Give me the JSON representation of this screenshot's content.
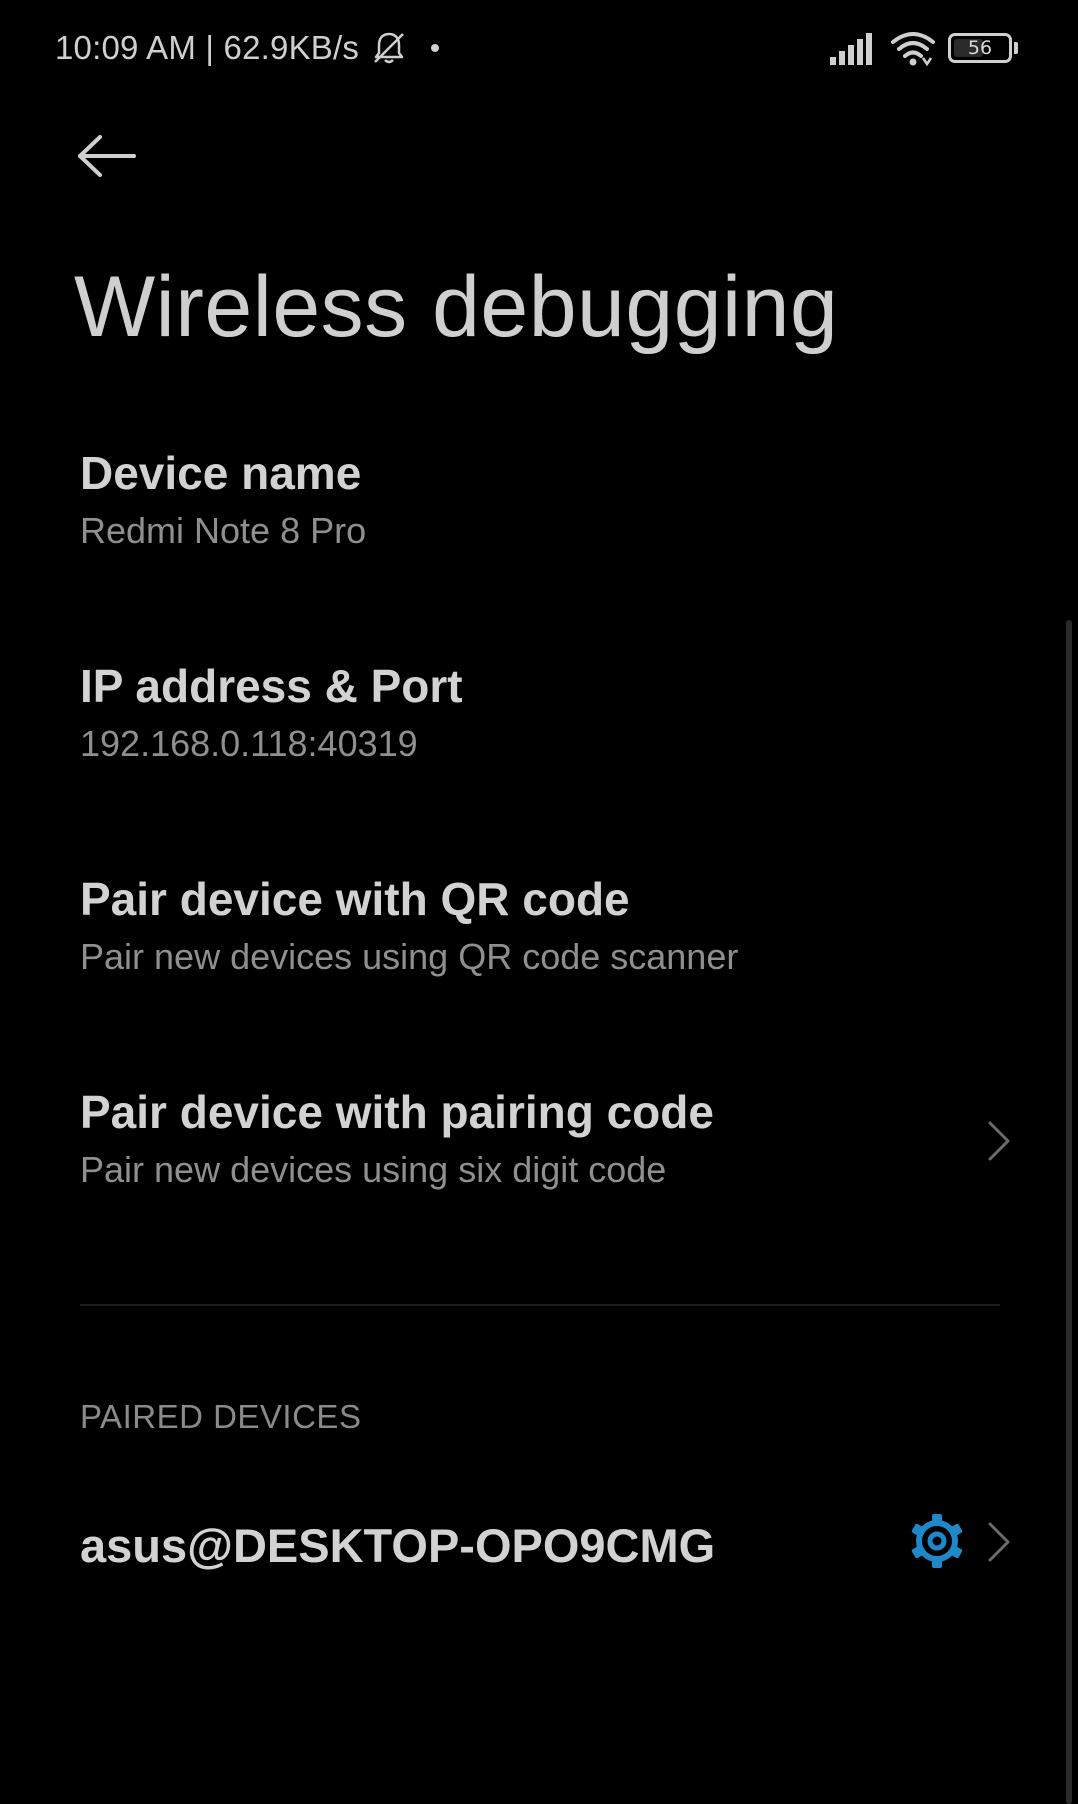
{
  "status_bar": {
    "time_speed": "10:09 AM | 62.9KB/s",
    "battery_level": "56",
    "icons": [
      "bell-off-icon",
      "signal-icon",
      "wifi-icon",
      "battery-icon"
    ]
  },
  "header": {
    "back_icon": "arrow-left-icon",
    "title": "Wireless debugging"
  },
  "items": [
    {
      "label": "Device name",
      "sub": "Redmi Note 8 Pro",
      "has_chevron": false
    },
    {
      "label": "IP address & Port",
      "sub": "192.168.0.118:40319",
      "has_chevron": false
    },
    {
      "label": "Pair device with QR code",
      "sub": "Pair new devices using QR code scanner",
      "has_chevron": false
    },
    {
      "label": "Pair device with pairing code",
      "sub": "Pair new devices using six digit code",
      "has_chevron": true
    }
  ],
  "paired_section": {
    "header": "PAIRED DEVICES",
    "devices": [
      {
        "label": "asus@DESKTOP-OPO9CMG",
        "settings_icon": "gear-icon"
      }
    ]
  },
  "colors": {
    "background": "#000000",
    "accent": "#1e88c8",
    "primary_text": "#d2d2d2",
    "secondary_text": "#8f8f8f"
  }
}
